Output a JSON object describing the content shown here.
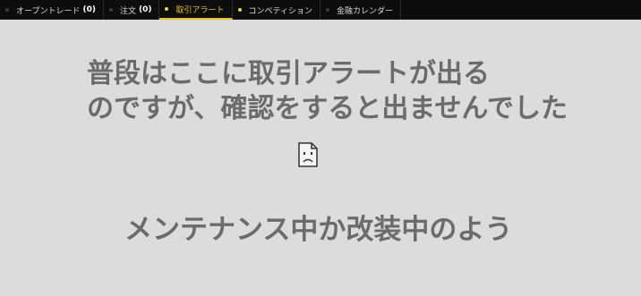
{
  "tabs": [
    {
      "label": "オープントレード",
      "count": "(0)",
      "dot": "dark",
      "active": false
    },
    {
      "label": "注文",
      "count": "(0)",
      "dot": "dark",
      "active": false
    },
    {
      "label": "取引アラート",
      "count": "",
      "dot": "yellow",
      "active": true
    },
    {
      "label": "コンペティション",
      "count": "",
      "dot": "yellow",
      "active": false
    },
    {
      "label": "金融カレンダー",
      "count": "",
      "dot": "dark",
      "active": false
    }
  ],
  "overlay": {
    "line1": "普段はここに取引アラートが出る",
    "line2": "のですが、確認をすると出ませんでした",
    "line3": "メンテナンス中か改装中のよう"
  },
  "icons": {
    "broken_image": "broken-image-icon"
  },
  "colors": {
    "tabbar_bg": "#0d0d0d",
    "active_tab": "#e6c233",
    "content_bg": "#dcdcdc",
    "overlay_text": "#6b6b6b"
  }
}
